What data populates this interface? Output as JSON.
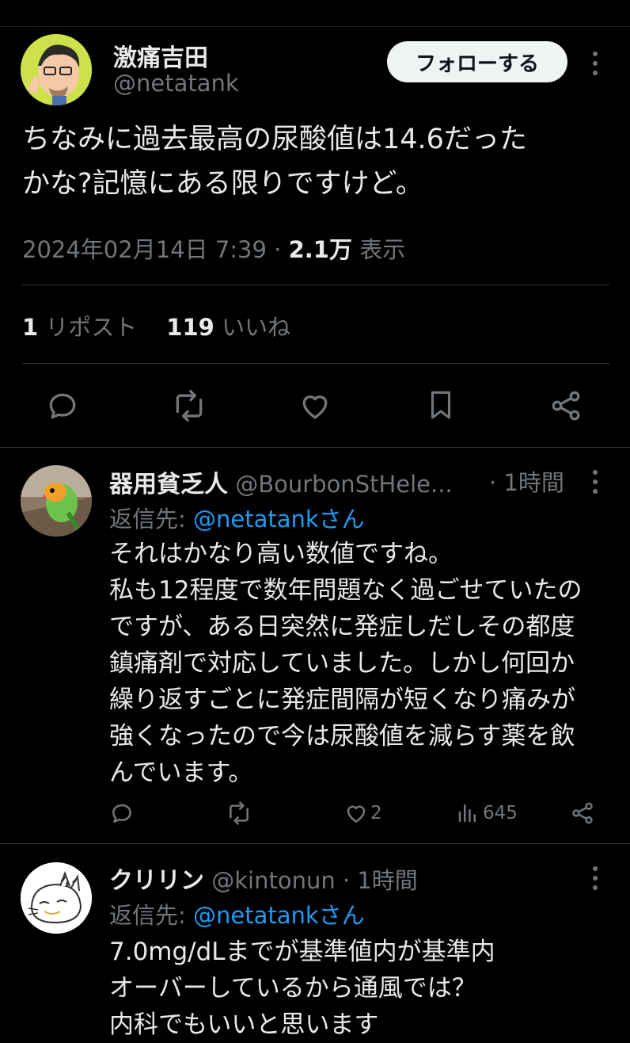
{
  "main_tweet": {
    "author_name": "激痛吉田",
    "author_handle": "@netatank",
    "follow_label": "フォローする",
    "text_line1": "ちなみに過去最高の尿酸値は14.6だった",
    "text_line2": "かな?記憶にある限りですけど。",
    "timestamp": "2024年02月14日 7:39",
    "separator": "·",
    "views": "2.1万",
    "views_label": "表示",
    "reposts_count": "1",
    "reposts_label": "リポスト",
    "likes_count": "119",
    "likes_label": "いいね"
  },
  "replies": [
    {
      "name": "器用貧乏人",
      "handle": "@BourbonStHele...",
      "time": "· 1時間",
      "replyto_prefix": "返信先:",
      "replyto_link": "@netatankさん",
      "lines": [
        "それはかなり高い数値ですね。",
        "私も12程度で数年問題なく過ごせていたの",
        "ですが、ある日突然に発症しだしその都度",
        "鎮痛剤で対応していました。しかし何回か",
        "繰り返すごとに発症間隔が短くなり痛みが",
        "強くなったので今は尿酸値を減らす薬を飲",
        "んでいます。"
      ],
      "like_count": "2",
      "view_count": "645"
    },
    {
      "name": "クリリン",
      "handle": "@kintonun · 1時間",
      "replyto_prefix": "返信先:",
      "replyto_link": "@netatankさん",
      "lines": [
        "7.0mg/dLまでが基準値内が基準内",
        "オーバーしているから通風では？",
        "内科でもいいと思います"
      ]
    }
  ],
  "colors": {
    "background": "#000000",
    "text": "#e7e9ea",
    "muted": "#71767b",
    "link": "#1d9bf0",
    "divider": "#2f3336"
  }
}
